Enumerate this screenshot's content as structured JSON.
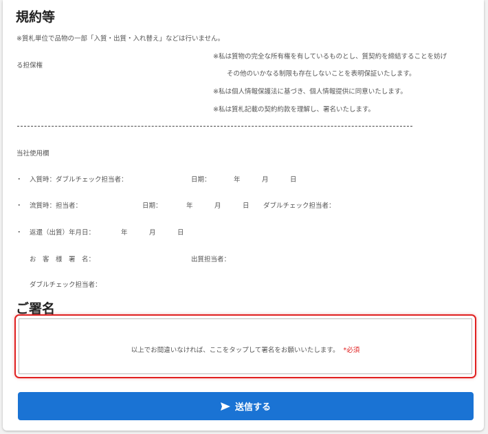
{
  "terms": {
    "title": "規約等",
    "note": "※質札単位で品物の一部「入質・出質・入れ替え」などは行いません。",
    "decl_1a": "※私は質物の完全な所有権を有しているものとし、質契約を締結することを妨げ",
    "decl_1b": "る担保権",
    "decl_1c": "その他のいかなる制限も存在しないことを表明保証いたします。",
    "decl_2": "※私は個人情報保護法に基づき、個人情報提供に同意いたします。",
    "decl_3": "※私は質札記載の契約約款を理解し、署名いたします。"
  },
  "office": {
    "label": "当社使用欄",
    "bullet": "・",
    "row1": {
      "label": "入質時：ダブルチェック担当者：",
      "date": "日期：",
      "year": "年",
      "month": "月",
      "day": "日"
    },
    "row2": {
      "label": "流質時：担当者：",
      "date": "日期：",
      "year": "年",
      "month": "月",
      "day": "日",
      "double": "ダブルチェック担当者："
    },
    "row3": {
      "label": "返還（出質）年月日：",
      "year": "年",
      "month": "月",
      "day": "日"
    },
    "customer": "お　客　様　署　名：",
    "withdraw": "出質担当者：",
    "double_check": "ダブルチェック担当者："
  },
  "signature": {
    "title": "ご署名",
    "prompt": "以上でお間違いなければ、ここをタップして署名をお願いいたします。",
    "required": "*必須"
  },
  "submit": {
    "label": "送信する",
    "icon": "send-icon"
  },
  "colors": {
    "accent": "#1a73d4",
    "required": "#e02020"
  }
}
